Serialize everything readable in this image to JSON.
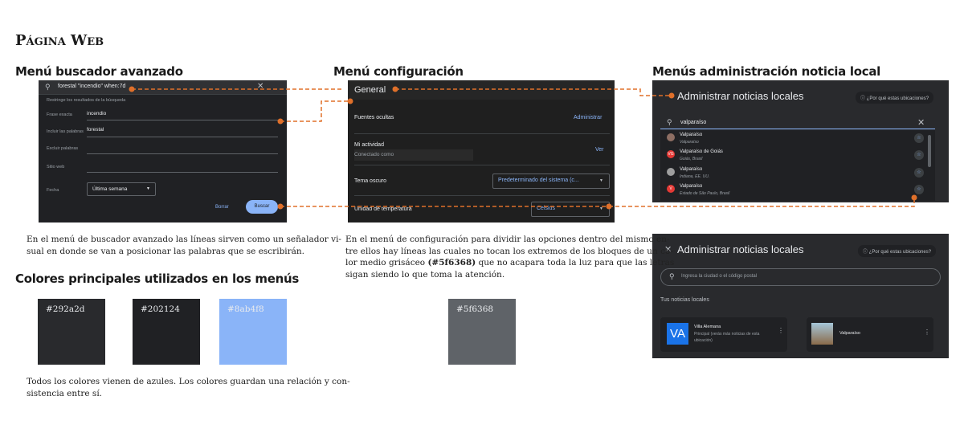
{
  "page_title": "Página Web",
  "sections": {
    "search": {
      "title": "Menú buscador avanzado",
      "description": [
        "En el menú de buscador avanzado las líneas sirven como un señalador vi-",
        "sual en donde se van a posicionar las palabras que se escribirán."
      ]
    },
    "config": {
      "title": "Menú configuración",
      "description_lines": [
        "En el menú de configuración para dividir las opciones dentro del mismo en-",
        "tre ellos hay líneas las cuales no tocan los extremos de los bloques de un co-"
      ],
      "description_line3_before": "lor medio grisáceo ",
      "description_line3_bold": "(#5f6368)",
      "description_line3_after": " que no acapara toda la luz para que las letras",
      "description_line4": "sigan siendo lo que toma la atención."
    },
    "admin": {
      "title": "Menús administración noticia local"
    },
    "colors": {
      "title": "Colores principales utilizados en los menús",
      "description": [
        "Todos los colores vienen de azules. Los colores guardan una relación y con-",
        "sistencia entre sí."
      ],
      "swatches": [
        {
          "label": "#292a2d",
          "color": "#292a2d",
          "text_color": "#e8eaed"
        },
        {
          "label": "#202124",
          "color": "#202124",
          "text_color": "#e8eaed"
        },
        {
          "label": "#8ab4f8",
          "color": "#8ab4f8",
          "text_color": "#e8eaed"
        },
        {
          "label": "#5f6368",
          "color": "#5f6368",
          "text_color": "#e8eaed"
        }
      ]
    }
  },
  "search_panel": {
    "query": "forestal \"incendio\" when:7d",
    "restrict_text": "Restringe los resultados de la búsqueda",
    "fields": [
      {
        "label": "Frase exacta",
        "value": "incendio"
      },
      {
        "label": "Incluir las palabras",
        "value": "forestal"
      },
      {
        "label": "Excluir palabras",
        "value": ""
      },
      {
        "label": "Sitio web",
        "value": ""
      }
    ],
    "date_label": "Fecha",
    "date_value": "Última semana",
    "clear_label": "Borrar",
    "search_label": "Buscar"
  },
  "config_panel": {
    "header": "General",
    "hidden_sources": "Fuentes ocultas",
    "manage": "Administrar",
    "activity": "Mi actividad",
    "connected_as": "Conectado como",
    "view": "Ver",
    "dark_theme": "Tema oscuro",
    "dark_theme_value": "Predeterminado del sistema (c...",
    "temp_unit": "Unidad de temperatura",
    "temp_value": "Celsius"
  },
  "admin_panel_1": {
    "title": "Administrar noticias locales",
    "why": "¿Por qué estas ubicaciones?",
    "search_text": "valparaíso",
    "results": [
      {
        "name": "Valparaíso",
        "sub": "Valparaíso",
        "avatar": "",
        "avatar_color": "#8d6e63"
      },
      {
        "name": "Valparaíso de Goiás",
        "sub": "Goiás, Brasil",
        "avatar": "VG",
        "avatar_color": "#e53935"
      },
      {
        "name": "Valparaíso",
        "sub": "Indiana, EE. UU.",
        "avatar": "",
        "avatar_color": "#9e9e9e"
      },
      {
        "name": "Valparaíso",
        "sub": "Estado de São Paulo, Brasil",
        "avatar": "V",
        "avatar_color": "#e53935"
      }
    ]
  },
  "admin_panel_2": {
    "title": "Administrar noticias locales",
    "why": "¿Por qué estas ubicaciones?",
    "search_placeholder": "Ingresa la ciudad o el código postal",
    "your_news": "Tus noticias locales",
    "cards": [
      {
        "avatar": "VA",
        "name": "Villa Alemana",
        "sub": "Principal (verás más noticias de esta ubicación)"
      },
      {
        "avatar": "",
        "name": "Valparaíso",
        "sub": ""
      }
    ]
  }
}
